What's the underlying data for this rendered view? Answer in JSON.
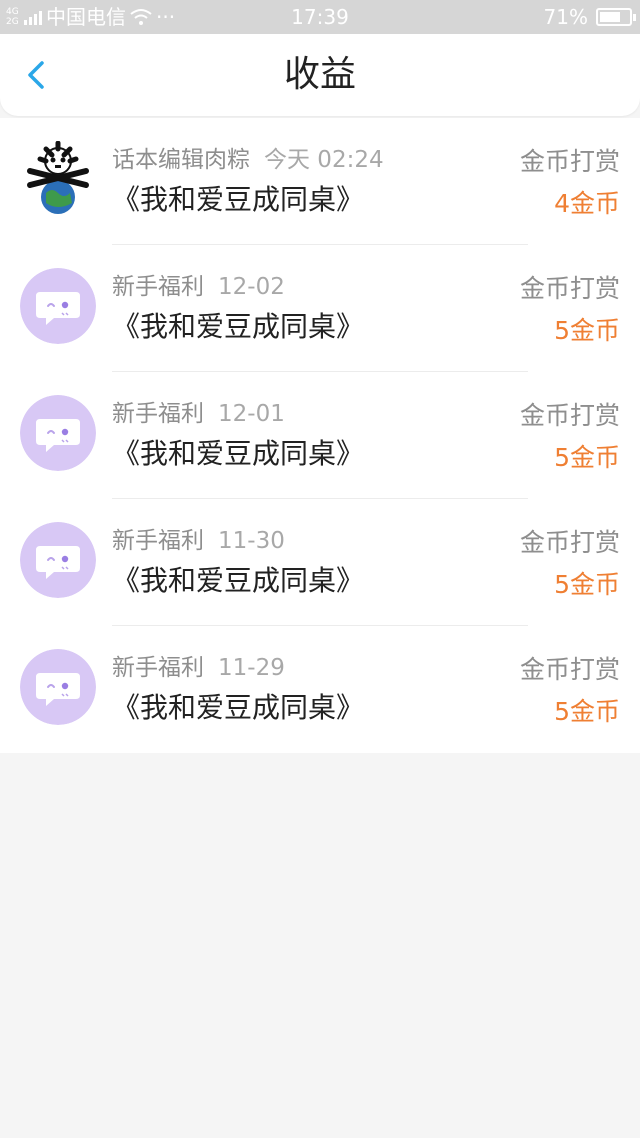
{
  "status_bar": {
    "network_label": "4G 2G",
    "carrier": "中国电信",
    "more": "···",
    "time": "17:39",
    "battery": "71%",
    "battery_level": 0.71
  },
  "nav": {
    "title": "收益"
  },
  "records": [
    {
      "avatar": "user-avatar-skull-globe",
      "source": "话本编辑肉粽",
      "date": "今天 02:24",
      "book": "《我和爱豆成同桌》",
      "type": "金币打赏",
      "amount": "4金币"
    },
    {
      "avatar": "chat-bubble-avatar",
      "source": "新手福利",
      "date": "12-02",
      "book": "《我和爱豆成同桌》",
      "type": "金币打赏",
      "amount": "5金币"
    },
    {
      "avatar": "chat-bubble-avatar",
      "source": "新手福利",
      "date": "12-01",
      "book": "《我和爱豆成同桌》",
      "type": "金币打赏",
      "amount": "5金币"
    },
    {
      "avatar": "chat-bubble-avatar",
      "source": "新手福利",
      "date": "11-30",
      "book": "《我和爱豆成同桌》",
      "type": "金币打赏",
      "amount": "5金币"
    },
    {
      "avatar": "chat-bubble-avatar",
      "source": "新手福利",
      "date": "11-29",
      "book": "《我和爱豆成同桌》",
      "type": "金币打赏",
      "amount": "5金币"
    }
  ],
  "colors": {
    "accent_blue": "#2aa7e8",
    "amount_orange": "#ef7f33",
    "avatar_purple": "#d8c8f5"
  }
}
